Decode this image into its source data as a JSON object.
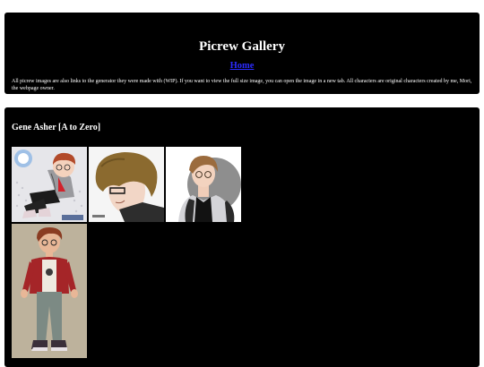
{
  "header": {
    "title": "Picrew Gallery",
    "home_link": "Home",
    "intro": "All picrew images are also links to the generator they were made with (WIP). If you want to view the full size image, you can open the image in a new tab. All characters are original characters created by me, Mori, the webpage owner."
  },
  "section": {
    "title": "Gene Asher [A to Zero]",
    "thumbs": [
      {
        "alt": "Gene Asher picrew 1",
        "icon": "character-sitting-icon"
      },
      {
        "alt": "Gene Asher picrew 2",
        "icon": "character-profile-icon"
      },
      {
        "alt": "Gene Asher picrew 3",
        "icon": "character-portrait-icon"
      },
      {
        "alt": "Gene Asher picrew 4",
        "icon": "character-fullbody-icon"
      }
    ]
  },
  "colors": {
    "page_background": "#ffffff",
    "panel_background": "#000000",
    "link": "#2b2bff",
    "text": "#ffffff"
  }
}
